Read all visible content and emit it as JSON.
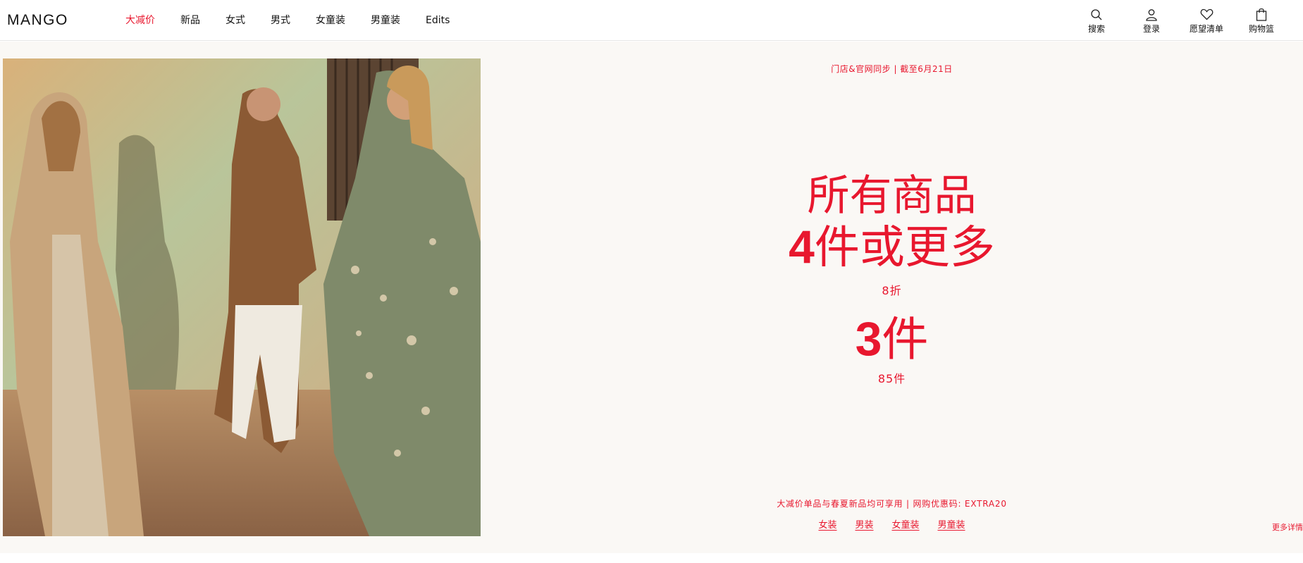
{
  "header": {
    "logo_text": "MANGO",
    "nav": [
      {
        "label": "大减价",
        "active": true
      },
      {
        "label": "新品"
      },
      {
        "label": "女式"
      },
      {
        "label": "男式"
      },
      {
        "label": "女童装"
      },
      {
        "label": "男童装"
      },
      {
        "label": "Edits"
      }
    ],
    "utilities": [
      {
        "label": "搜索",
        "icon": "search-icon"
      },
      {
        "label": "登录",
        "icon": "user-icon"
      },
      {
        "label": "愿望清单",
        "icon": "heart-icon"
      },
      {
        "label": "购物篮",
        "icon": "shopping-bag-icon"
      }
    ]
  },
  "promo": {
    "top_line": "门店&官网同步 | 截至6月21日",
    "headline_1": "所有商品",
    "headline_2_num": "4",
    "headline_2_text": "件或更多",
    "discount_1": "8折",
    "headline_3_num": "3",
    "headline_3_text": "件",
    "discount_2": "85件",
    "note": "大减价单品与春夏新品均可享用 | 网购优惠码: EXTRA20",
    "links": [
      "女装",
      "男装",
      "女童装",
      "男童装"
    ],
    "more_details": "更多详情"
  },
  "colors": {
    "accent": "#e8172e",
    "background": "#faf8f5"
  }
}
